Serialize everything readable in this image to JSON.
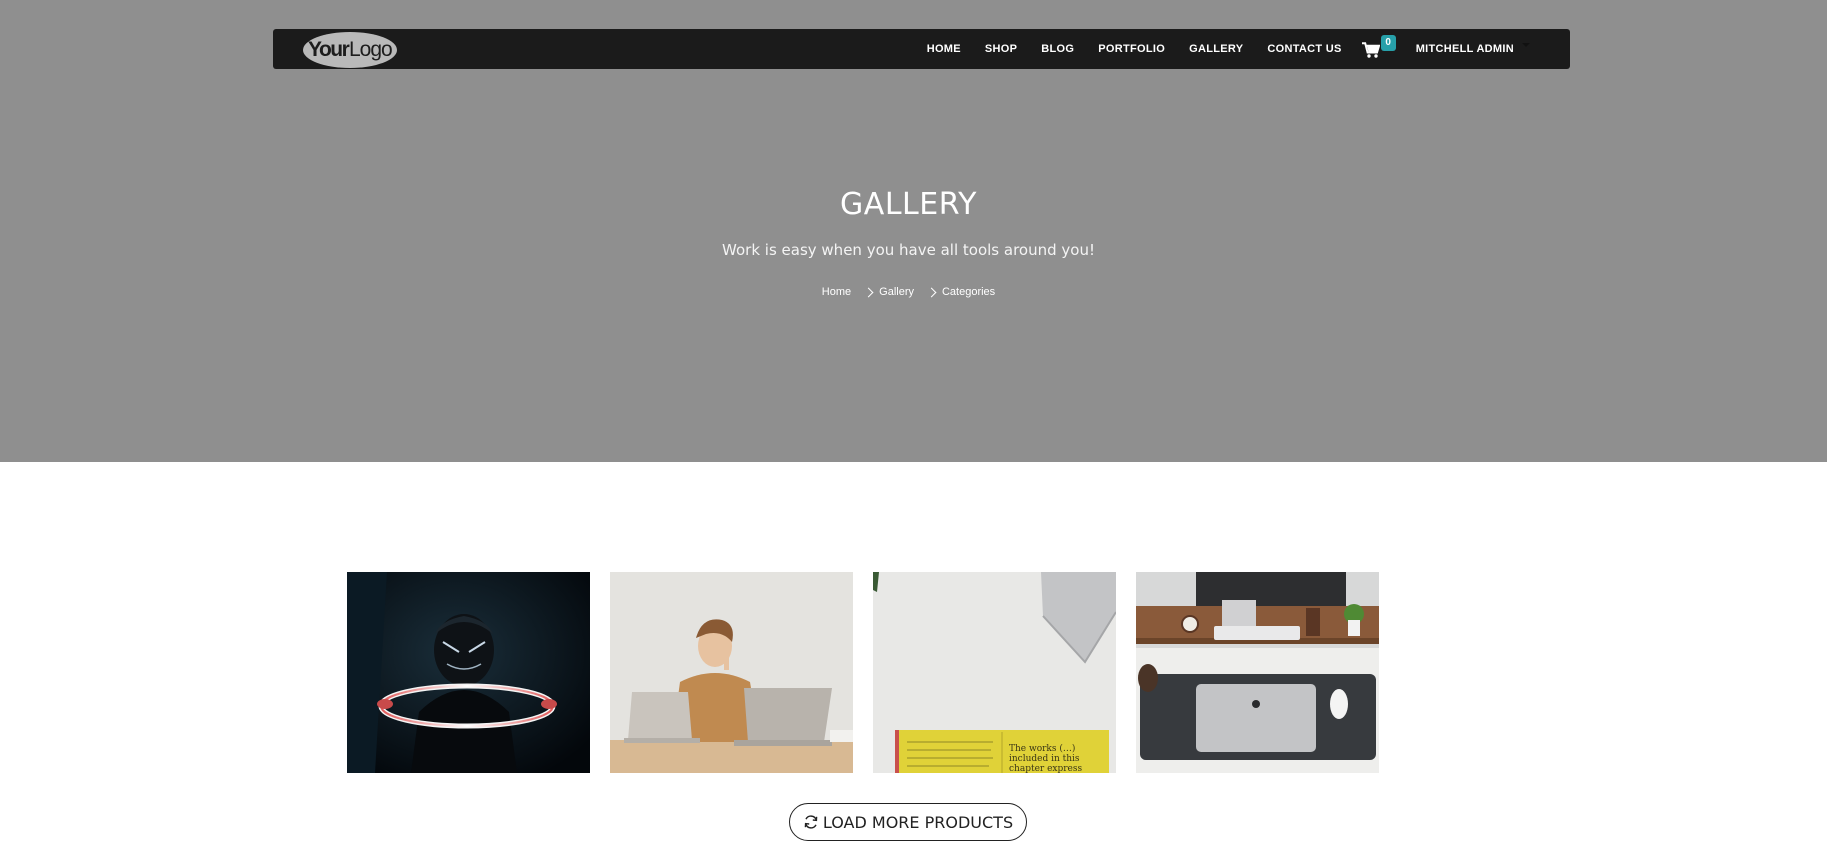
{
  "header": {
    "logo_text": "YourLogo",
    "nav": [
      "HOME",
      "SHOP",
      "BLOG",
      "PORTFOLIO",
      "GALLERY",
      "CONTACT US"
    ],
    "cart_count": "0",
    "user_name": "MITCHELL ADMIN"
  },
  "hero": {
    "title": "GALLERY",
    "subtitle": "Work is easy when you have all tools around you!",
    "breadcrumb": [
      "Home",
      "Gallery",
      "Categories"
    ]
  },
  "gallery": {
    "images": [
      {
        "icon": "person-with-light-ring-photo"
      },
      {
        "icon": "man-with-laptops-photo"
      },
      {
        "icon": "desk-with-yellow-book-photo"
      },
      {
        "icon": "desk-setup-with-laptop-photo"
      }
    ],
    "book_text": "The works (...) included in this chapter express"
  },
  "actions": {
    "load_more_label": "LOAD MORE PRODUCTS"
  },
  "colors": {
    "hero_bg": "#8f8f8f",
    "navbar_bg": "#1b1b1b",
    "cart_badge": "#27a0a9"
  }
}
